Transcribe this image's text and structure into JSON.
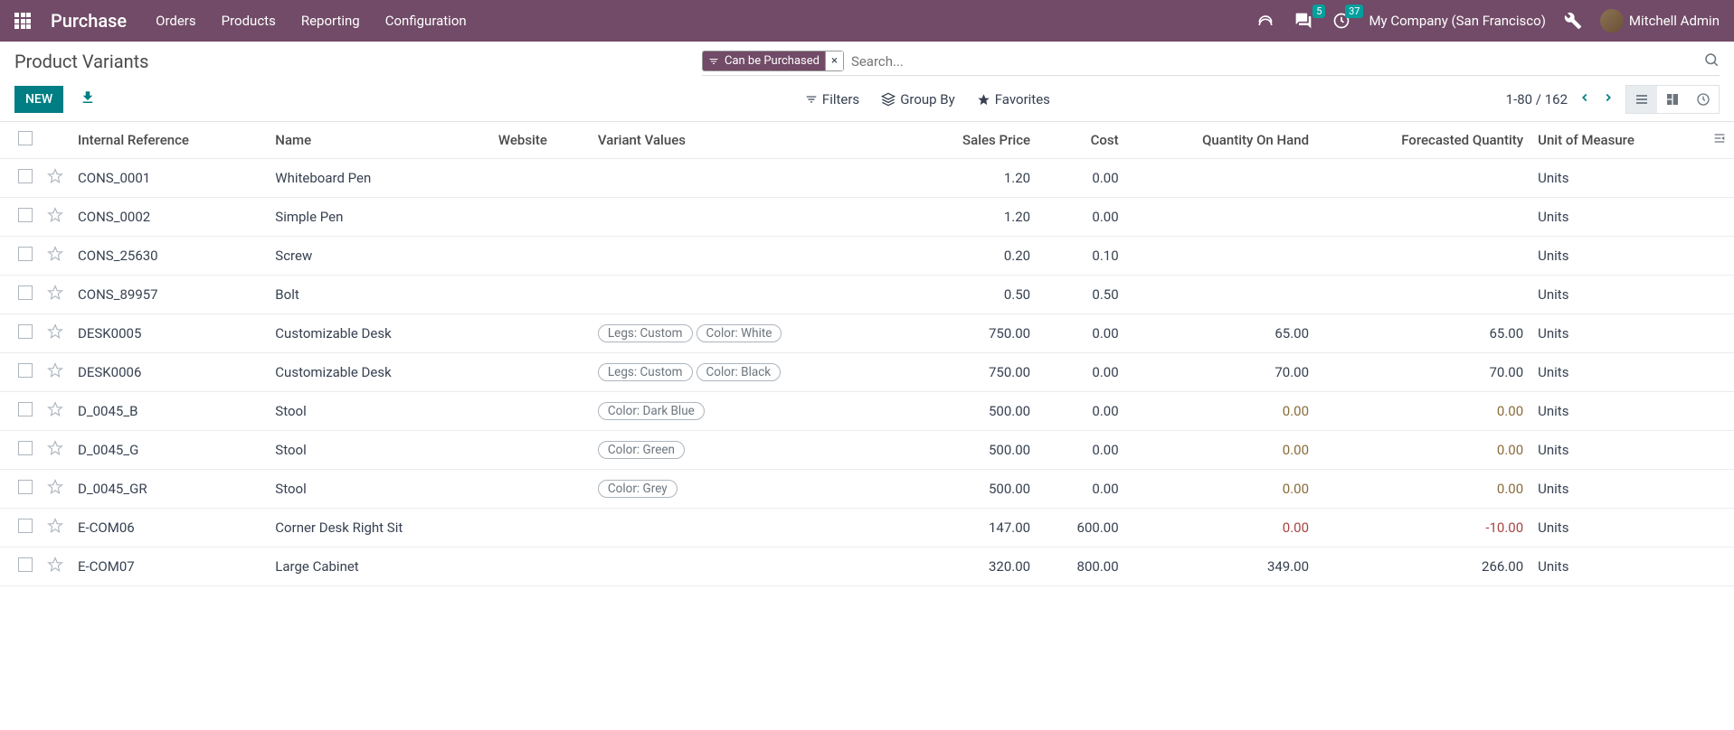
{
  "nav": {
    "brand": "Purchase",
    "menu": [
      "Orders",
      "Products",
      "Reporting",
      "Configuration"
    ],
    "badge_msg": "5",
    "badge_activity": "37",
    "company": "My Company (San Francisco)",
    "user": "Mitchell Admin"
  },
  "cp": {
    "title": "Product Variants",
    "filter_chip": "Can be Purchased",
    "search_placeholder": "Search...",
    "new_btn": "NEW",
    "filters": "Filters",
    "groupby": "Group By",
    "favorites": "Favorites",
    "pager": "1-80 / 162"
  },
  "columns": {
    "ref": "Internal Reference",
    "name": "Name",
    "website": "Website",
    "variant": "Variant Values",
    "price": "Sales Price",
    "cost": "Cost",
    "qty": "Quantity On Hand",
    "forecast": "Forecasted Quantity",
    "uom": "Unit of Measure"
  },
  "rows": [
    {
      "ref": "CONS_0001",
      "name": "Whiteboard Pen",
      "variants": [],
      "price": "1.20",
      "cost": "0.00",
      "qty": "",
      "forecast": "",
      "uom": "Units"
    },
    {
      "ref": "CONS_0002",
      "name": "Simple Pen",
      "variants": [],
      "price": "1.20",
      "cost": "0.00",
      "qty": "",
      "forecast": "",
      "uom": "Units"
    },
    {
      "ref": "CONS_25630",
      "name": "Screw",
      "variants": [],
      "price": "0.20",
      "cost": "0.10",
      "qty": "",
      "forecast": "",
      "uom": "Units"
    },
    {
      "ref": "CONS_89957",
      "name": "Bolt",
      "variants": [],
      "price": "0.50",
      "cost": "0.50",
      "qty": "",
      "forecast": "",
      "uom": "Units"
    },
    {
      "ref": "DESK0005",
      "name": "Customizable Desk",
      "variants": [
        "Legs: Custom",
        "Color: White"
      ],
      "price": "750.00",
      "cost": "0.00",
      "qty": "65.00",
      "forecast": "65.00",
      "uom": "Units"
    },
    {
      "ref": "DESK0006",
      "name": "Customizable Desk",
      "variants": [
        "Legs: Custom",
        "Color: Black"
      ],
      "price": "750.00",
      "cost": "0.00",
      "qty": "70.00",
      "forecast": "70.00",
      "uom": "Units"
    },
    {
      "ref": "D_0045_B",
      "name": "Stool",
      "variants": [
        "Color: Dark Blue"
      ],
      "price": "500.00",
      "cost": "0.00",
      "qty": "0.00",
      "qty_cls": "warn",
      "forecast": "0.00",
      "forecast_cls": "warn",
      "uom": "Units"
    },
    {
      "ref": "D_0045_G",
      "name": "Stool",
      "variants": [
        "Color: Green"
      ],
      "price": "500.00",
      "cost": "0.00",
      "qty": "0.00",
      "qty_cls": "warn",
      "forecast": "0.00",
      "forecast_cls": "warn",
      "uom": "Units"
    },
    {
      "ref": "D_0045_GR",
      "name": "Stool",
      "variants": [
        "Color: Grey"
      ],
      "price": "500.00",
      "cost": "0.00",
      "qty": "0.00",
      "qty_cls": "warn",
      "forecast": "0.00",
      "forecast_cls": "warn",
      "uom": "Units"
    },
    {
      "ref": "E-COM06",
      "name": "Corner Desk Right Sit",
      "variants": [],
      "price": "147.00",
      "cost": "600.00",
      "qty": "0.00",
      "qty_cls": "neg",
      "forecast": "-10.00",
      "forecast_cls": "neg",
      "uom": "Units"
    },
    {
      "ref": "E-COM07",
      "name": "Large Cabinet",
      "variants": [],
      "price": "320.00",
      "cost": "800.00",
      "qty": "349.00",
      "forecast": "266.00",
      "uom": "Units"
    }
  ]
}
